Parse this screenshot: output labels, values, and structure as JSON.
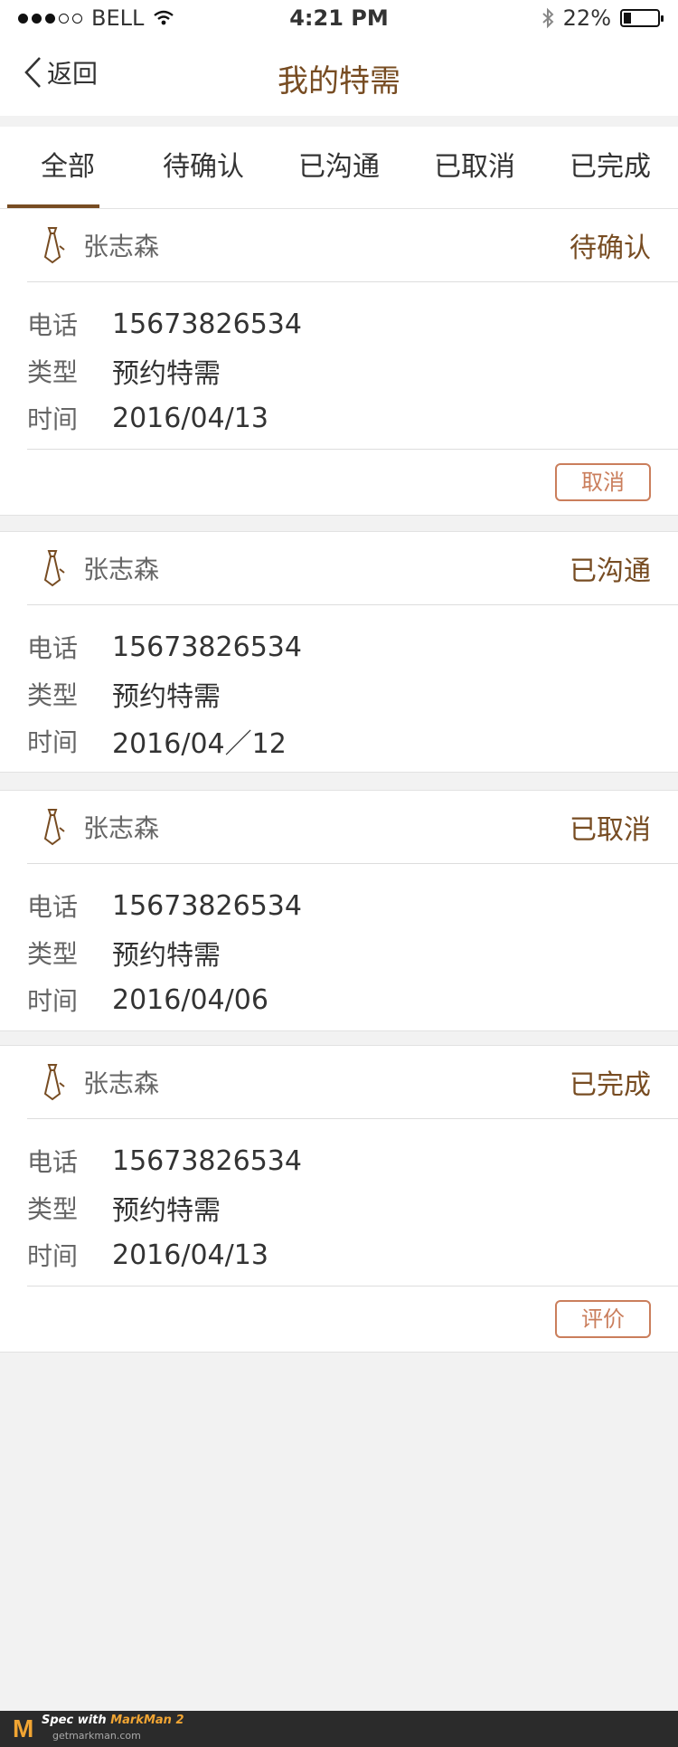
{
  "status_bar": {
    "carrier": "BELL",
    "time": "4:21 PM",
    "battery_text": "22%",
    "battery_level": 0.22
  },
  "nav": {
    "back_label": "返回",
    "title": "我的特需"
  },
  "tabs": [
    {
      "label": "全部",
      "active": true
    },
    {
      "label": "待确认",
      "active": false
    },
    {
      "label": "已沟通",
      "active": false
    },
    {
      "label": "已取消",
      "active": false
    },
    {
      "label": "已完成",
      "active": false
    }
  ],
  "labels": {
    "phone": "电话",
    "type": "类型",
    "time": "时间"
  },
  "orders": [
    {
      "name": "张志森",
      "status": "待确认",
      "phone": "15673826534",
      "type": "预约特需",
      "date": "2016/04/13",
      "action": "取消"
    },
    {
      "name": "张志森",
      "status": "已沟通",
      "phone": "15673826534",
      "type": "预约特需",
      "date": "2016/04／12",
      "action": ""
    },
    {
      "name": "张志森",
      "status": "已取消",
      "phone": "15673826534",
      "type": "预约特需",
      "date": "2016/04/06",
      "action": ""
    },
    {
      "name": "张志森",
      "status": "已完成",
      "phone": "15673826534",
      "type": "预约特需",
      "date": "2016/04/13",
      "action": "评价"
    }
  ],
  "badge": {
    "prefix": "Spec with ",
    "brand": "MarkMan 2",
    "url": "getmarkman.com"
  },
  "colors": {
    "accent": "#774c22",
    "button": "#ca7e5c",
    "text": "#333333",
    "subtext": "#666666",
    "divider": "#dddddd",
    "bg": "#f4f4f4"
  }
}
